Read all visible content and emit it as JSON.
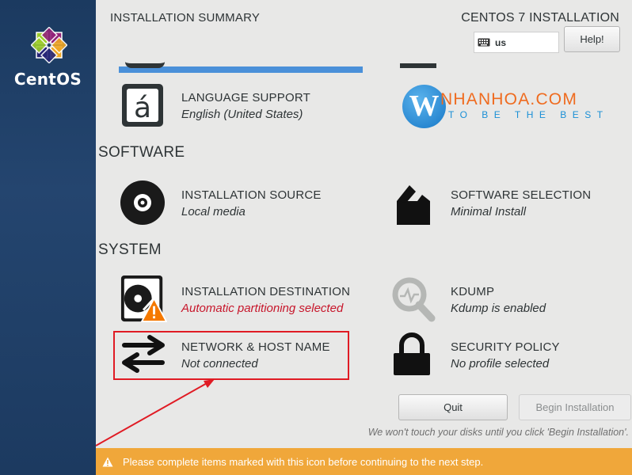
{
  "sidebar": {
    "logo_text": "CentOS"
  },
  "header": {
    "title": "INSTALLATION SUMMARY",
    "product": "CENTOS 7 INSTALLATION",
    "keyboard_layout": "us",
    "help_label": "Help!"
  },
  "sections": {
    "software": "SOFTWARE",
    "system": "SYSTEM"
  },
  "spokes": {
    "language": {
      "title": "LANGUAGE SUPPORT",
      "status": "English (United States)"
    },
    "source": {
      "title": "INSTALLATION SOURCE",
      "status": "Local media"
    },
    "software": {
      "title": "SOFTWARE SELECTION",
      "status": "Minimal Install"
    },
    "destination": {
      "title": "INSTALLATION DESTINATION",
      "status": "Automatic partitioning selected"
    },
    "kdump": {
      "title": "KDUMP",
      "status": "Kdump is enabled"
    },
    "network": {
      "title": "NETWORK & HOST NAME",
      "status": "Not connected"
    },
    "security": {
      "title": "SECURITY POLICY",
      "status": "No profile selected"
    }
  },
  "watermark": {
    "letter": "W",
    "name": "NHANHOA.COM",
    "tagline": "TO BE THE BEST"
  },
  "footer": {
    "quit_label": "Quit",
    "begin_label": "Begin Installation",
    "note": "We won't touch your disks until you click 'Begin Installation'.",
    "warning": "Please complete items marked with this icon before continuing to the next step."
  },
  "colors": {
    "sidebar": "#1b3a60",
    "warning_bar": "#f0a73a",
    "warning_text": "#c7162b",
    "highlight_box": "#e01b24",
    "brand_orange": "#ef6b1f",
    "brand_blue": "#1a8fd6"
  }
}
